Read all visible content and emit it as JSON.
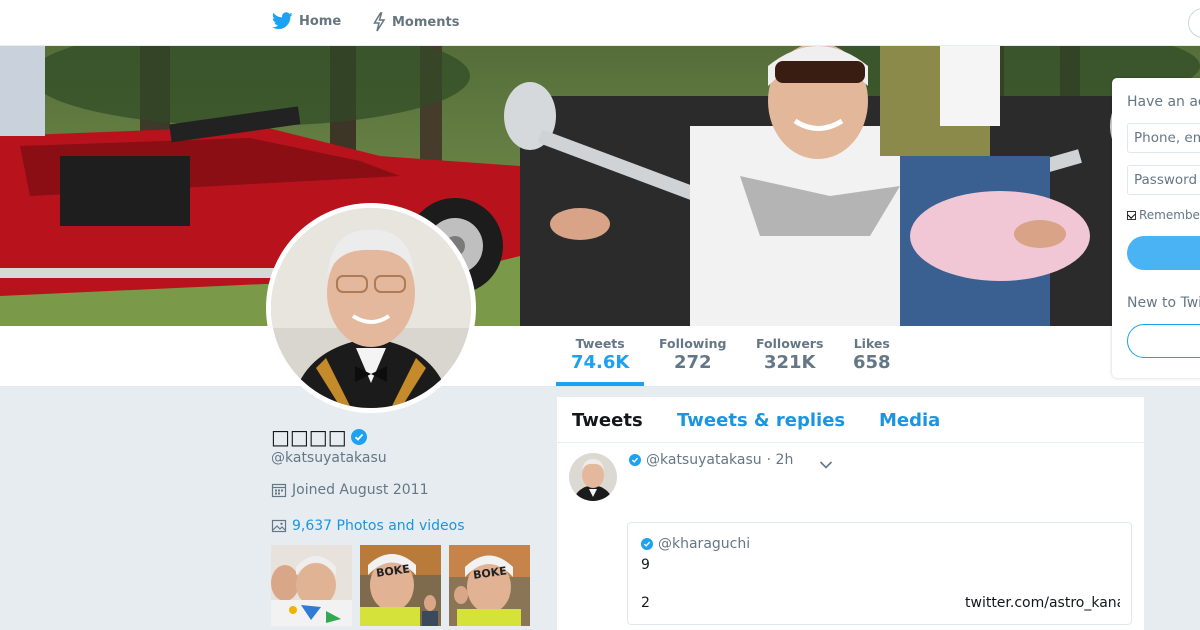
{
  "nav": {
    "home_label": "Home",
    "moments_label": "Moments"
  },
  "profile": {
    "display_name": "□□□□",
    "handle": "@katsuyatakasu",
    "joined": "Joined August 2011",
    "photos_link": "9,637 Photos and videos",
    "verified": true
  },
  "stats": [
    {
      "label": "Tweets",
      "value": "74.6K",
      "active": true
    },
    {
      "label": "Following",
      "value": "272",
      "active": false
    },
    {
      "label": "Followers",
      "value": "321K",
      "active": false
    },
    {
      "label": "Likes",
      "value": "658",
      "active": false
    }
  ],
  "timeline": {
    "tabs": [
      {
        "label": "Tweets",
        "active": true
      },
      {
        "label": "Tweets & replies",
        "active": false
      },
      {
        "label": "Media",
        "active": false
      }
    ],
    "tweet": {
      "handle": "@katsuyatakasu",
      "time": "· 2h",
      "quote": {
        "handle": "@kharaguchi",
        "line1": "9",
        "line2": "2",
        "link": "twitter.com/astro_kana..."
      }
    }
  },
  "login": {
    "title": "Have an account?",
    "phone_placeholder": "Phone, email or username",
    "password_placeholder": "Password",
    "remember_label": "Remember me",
    "new_label": "New to Twitter?"
  },
  "colors": {
    "accent": "#1da1f2",
    "link": "#1b95e0",
    "muted": "#657786",
    "background": "#e6ecf0"
  }
}
